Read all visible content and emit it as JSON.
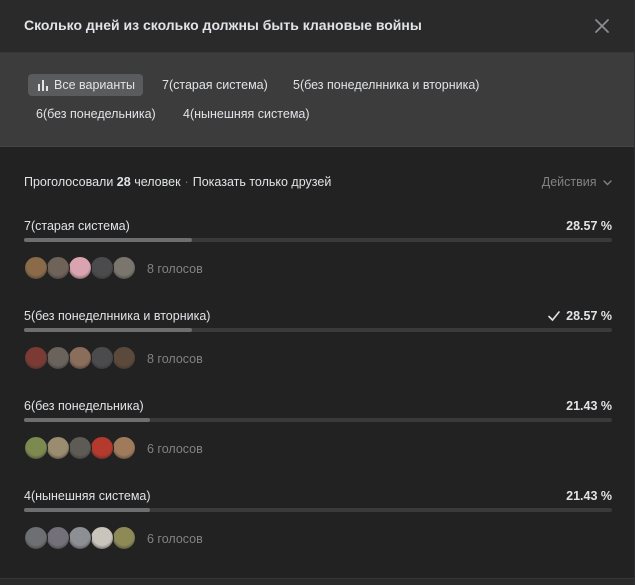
{
  "title": "Сколько дней из сколько должны быть клановые войны",
  "filters": [
    {
      "label": "Все варианты",
      "active": true
    },
    {
      "label": "7(старая система)"
    },
    {
      "label": "5(без понеделнника и вторника)"
    },
    {
      "label": "6(без понедельника)"
    },
    {
      "label": "4(нынешняя система)"
    }
  ],
  "summary": {
    "prefix": "Проголосовали",
    "count": "28",
    "suffix": "человек",
    "separator": "·",
    "friends_link": "Показать только друзей"
  },
  "actions_label": "Действия",
  "options": [
    {
      "label": "7(старая система)",
      "percent": "28.57 %",
      "fraction": 0.2857,
      "votes": "8 голосов",
      "voted": false,
      "avatars": [
        "#8b6a4a",
        "#6e6259",
        "#d9a4b0",
        "#4b4b4d",
        "#7a766d"
      ]
    },
    {
      "label": "5(без понеделнника и вторника)",
      "percent": "28.57 %",
      "fraction": 0.2857,
      "votes": "8 голосов",
      "voted": true,
      "avatars": [
        "#7b3b34",
        "#6a635c",
        "#8a6d5a",
        "#4b4b4d",
        "#5b4a3c"
      ]
    },
    {
      "label": "6(без понедельника)",
      "percent": "21.43 %",
      "fraction": 0.2143,
      "votes": "6 голосов",
      "voted": false,
      "avatars": [
        "#7d8a4f",
        "#9a8c6e",
        "#5e5a55",
        "#b43a2e",
        "#a07b5b"
      ]
    },
    {
      "label": "4(нынешняя система)",
      "percent": "21.43 %",
      "fraction": 0.2143,
      "votes": "6 голосов",
      "voted": false,
      "avatars": [
        "#6d6f72",
        "#73707a",
        "#8c8f93",
        "#c9c4bc",
        "#8d8a57"
      ]
    }
  ]
}
